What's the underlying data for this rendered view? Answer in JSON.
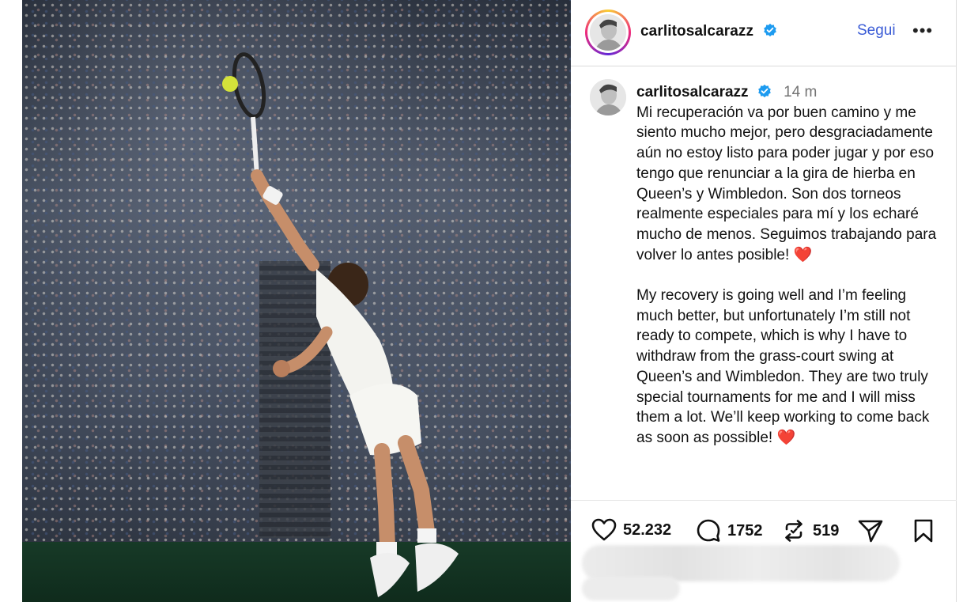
{
  "post": {
    "username": "carlitosalcarazz",
    "follow_label": "Segui",
    "more_label": "•••",
    "time_ago": "14 m",
    "caption_es": "Mi recuperación va por buen camino y me siento mucho mejor, pero desgraciadamente aún no estoy listo para poder jugar y por eso tengo que renunciar a la gira de hierba en Queen’s y Wimbledon. Son dos torneos realmente especiales para mí y los echaré mucho de menos. Seguimos trabajando para volver lo antes posible!",
    "caption_en": "My recovery is going well and I’m feeling much better, but unfortunately I’m still not ready to compete, which is why I have to withdraw from the grass-court swing at Queen’s and Wimbledon. They are two truly special tournaments for me and I will miss them a lot. We’ll keep working to come back as soon as possible!",
    "heart_emoji": "❤️"
  },
  "stats": {
    "likes": "52.232",
    "comments": "1752",
    "reposts": "519"
  },
  "icons": {
    "like": "heart-icon",
    "comment": "comment-icon",
    "repost": "repost-icon",
    "share": "share-icon",
    "save": "bookmark-icon",
    "verified": "verified-badge-icon"
  },
  "colors": {
    "link_blue": "#3b5cd6",
    "verified_blue": "#1d9bf0",
    "heart_red": "#e0243a"
  }
}
